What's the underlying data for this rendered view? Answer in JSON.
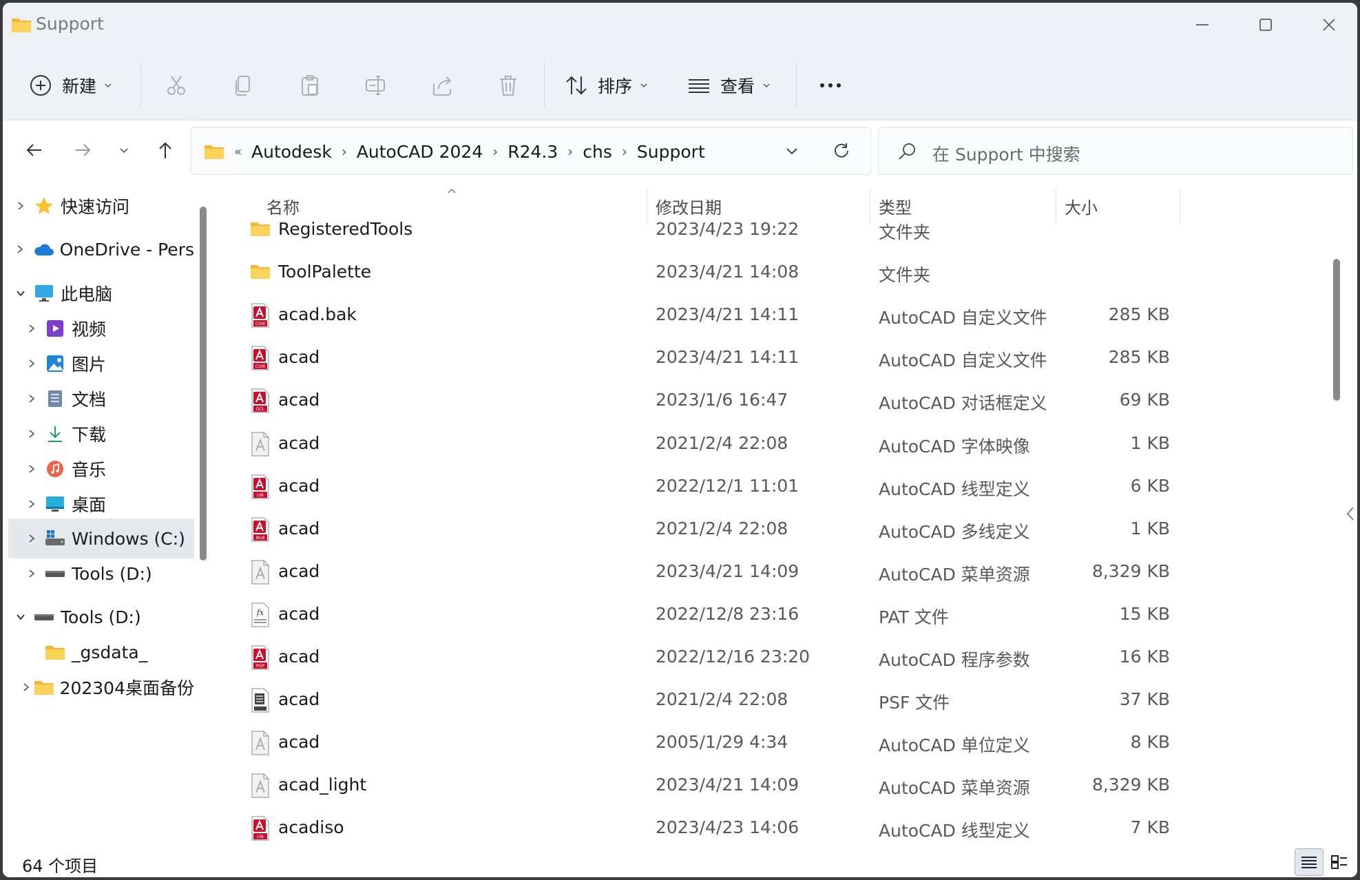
{
  "window": {
    "title": "Support"
  },
  "toolbar": {
    "new_label": "新建",
    "sort_label": "排序",
    "view_label": "查看"
  },
  "address": {
    "crumbs": [
      "Autodesk",
      "AutoCAD 2024",
      "R24.3",
      "chs",
      "Support"
    ],
    "search_placeholder": "在 Support 中搜索"
  },
  "nav": {
    "items": [
      {
        "label": "快速访问",
        "icon": "star-icon"
      },
      {
        "label": "OneDrive - Pers",
        "icon": "cloud-icon"
      },
      {
        "label": "此电脑",
        "icon": "monitor-icon"
      },
      {
        "label": "视频",
        "icon": "video-icon"
      },
      {
        "label": "图片",
        "icon": "picture-icon"
      },
      {
        "label": "文档",
        "icon": "document-icon"
      },
      {
        "label": "下载",
        "icon": "download-icon"
      },
      {
        "label": "音乐",
        "icon": "music-icon"
      },
      {
        "label": "桌面",
        "icon": "desktop-icon"
      },
      {
        "label": "Windows (C:)",
        "icon": "windows-drive-icon"
      },
      {
        "label": "Tools (D:)",
        "icon": "drive-icon"
      },
      {
        "label": "Tools (D:)",
        "icon": "drive-icon"
      },
      {
        "label": "_gsdata_",
        "icon": "folder-icon"
      },
      {
        "label": "202304桌面备份",
        "icon": "folder-icon"
      }
    ]
  },
  "columns": {
    "name": "名称",
    "date": "修改日期",
    "type": "类型",
    "size": "大小"
  },
  "files": [
    {
      "name": "RegisteredTools",
      "date": "2023/4/23 19:22",
      "type": "文件夹",
      "size": "",
      "icon": "folder-icon"
    },
    {
      "name": "ToolPalette",
      "date": "2023/4/21 14:08",
      "type": "文件夹",
      "size": "",
      "icon": "folder-icon"
    },
    {
      "name": "acad.bak",
      "date": "2023/4/21 14:11",
      "type": "AutoCAD 自定义文件",
      "size": "285 KB",
      "icon": "autocad-cuix-icon"
    },
    {
      "name": "acad",
      "date": "2023/4/21 14:11",
      "type": "AutoCAD 自定义文件",
      "size": "285 KB",
      "icon": "autocad-cuix-icon"
    },
    {
      "name": "acad",
      "date": "2023/1/6 16:47",
      "type": "AutoCAD 对话框定义",
      "size": "69 KB",
      "icon": "autocad-dcl-icon"
    },
    {
      "name": "acad",
      "date": "2021/2/4 22:08",
      "type": "AutoCAD 字体映像",
      "size": "1 KB",
      "icon": "generic-file-icon"
    },
    {
      "name": "acad",
      "date": "2022/12/1 11:01",
      "type": "AutoCAD 线型定义",
      "size": "6 KB",
      "icon": "autocad-lin-icon"
    },
    {
      "name": "acad",
      "date": "2021/2/4 22:08",
      "type": "AutoCAD 多线定义",
      "size": "1 KB",
      "icon": "autocad-mln-icon"
    },
    {
      "name": "acad",
      "date": "2023/4/21 14:09",
      "type": "AutoCAD 菜单资源",
      "size": "8,329 KB",
      "icon": "generic-file-icon"
    },
    {
      "name": "acad",
      "date": "2022/12/8 23:16",
      "type": "PAT 文件",
      "size": "15 KB",
      "icon": "pattern-file-icon"
    },
    {
      "name": "acad",
      "date": "2022/12/16 23:20",
      "type": "AutoCAD 程序参数",
      "size": "16 KB",
      "icon": "autocad-pgp-icon"
    },
    {
      "name": "acad",
      "date": "2021/2/4 22:08",
      "type": "PSF 文件",
      "size": "37 KB",
      "icon": "text-file-icon"
    },
    {
      "name": "acad",
      "date": "2005/1/29 4:34",
      "type": "AutoCAD 单位定义",
      "size": "8 KB",
      "icon": "generic-file-icon"
    },
    {
      "name": "acad_light",
      "date": "2023/4/21 14:09",
      "type": "AutoCAD 菜单资源",
      "size": "8,329 KB",
      "icon": "generic-file-icon"
    },
    {
      "name": "acadiso",
      "date": "2023/4/23 14:06",
      "type": "AutoCAD 线型定义",
      "size": "7 KB",
      "icon": "autocad-lin-icon"
    }
  ],
  "status": {
    "item_count": "64 个项目"
  },
  "colors": {
    "accent": "#0067c0",
    "autocad_red": "#c8102e",
    "folder_yellow": "#f8c542"
  }
}
